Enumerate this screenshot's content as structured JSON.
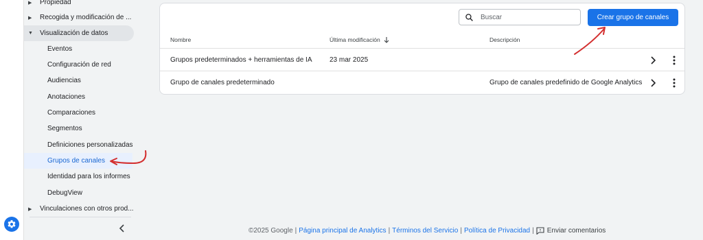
{
  "sidebar": {
    "items": [
      {
        "label": "Propiedad",
        "type": "parent"
      },
      {
        "label": "Recogida y modificación de ...",
        "type": "parent"
      },
      {
        "label": "Visualización de datos",
        "type": "parent-expanded"
      },
      {
        "label": "Eventos",
        "type": "child"
      },
      {
        "label": "Configuración de red",
        "type": "child"
      },
      {
        "label": "Audiencias",
        "type": "child"
      },
      {
        "label": "Anotaciones",
        "type": "child"
      },
      {
        "label": "Comparaciones",
        "type": "child"
      },
      {
        "label": "Segmentos",
        "type": "child"
      },
      {
        "label": "Definiciones personalizadas",
        "type": "child"
      },
      {
        "label": "Grupos de canales",
        "type": "child-selected"
      },
      {
        "label": "Identidad para los informes",
        "type": "child"
      },
      {
        "label": "DebugView",
        "type": "child"
      },
      {
        "label": "Vinculaciones con otros prod...",
        "type": "parent"
      }
    ],
    "collapse_icon": "chevron-left-icon",
    "settings_icon": "gear-icon"
  },
  "toolbar": {
    "search_placeholder": "Buscar",
    "search_icon": "search-icon",
    "create_label": "Crear grupo de canales"
  },
  "table": {
    "columns": {
      "name": "Nombre",
      "modified": "Última modificación",
      "description": "Descripción"
    },
    "sort_icon": "arrow-down-icon",
    "rows": [
      {
        "name": "Grupos predeterminados + herramientas de IA",
        "modified": "23 mar 2025",
        "description": ""
      },
      {
        "name": "Grupo de canales predeterminado",
        "modified": "",
        "description": "Grupo de canales predefinido de Google Analytics"
      }
    ]
  },
  "footer": {
    "copyright": "©2025 Google",
    "links": [
      "Página principal de Analytics",
      "Términos del Servicio",
      "Política de Privacidad"
    ],
    "feedback": "Enviar comentarios"
  },
  "colors": {
    "accent": "#1a73e8",
    "selected_bg": "#e8f0fe",
    "annotation": "#d32f2f"
  }
}
